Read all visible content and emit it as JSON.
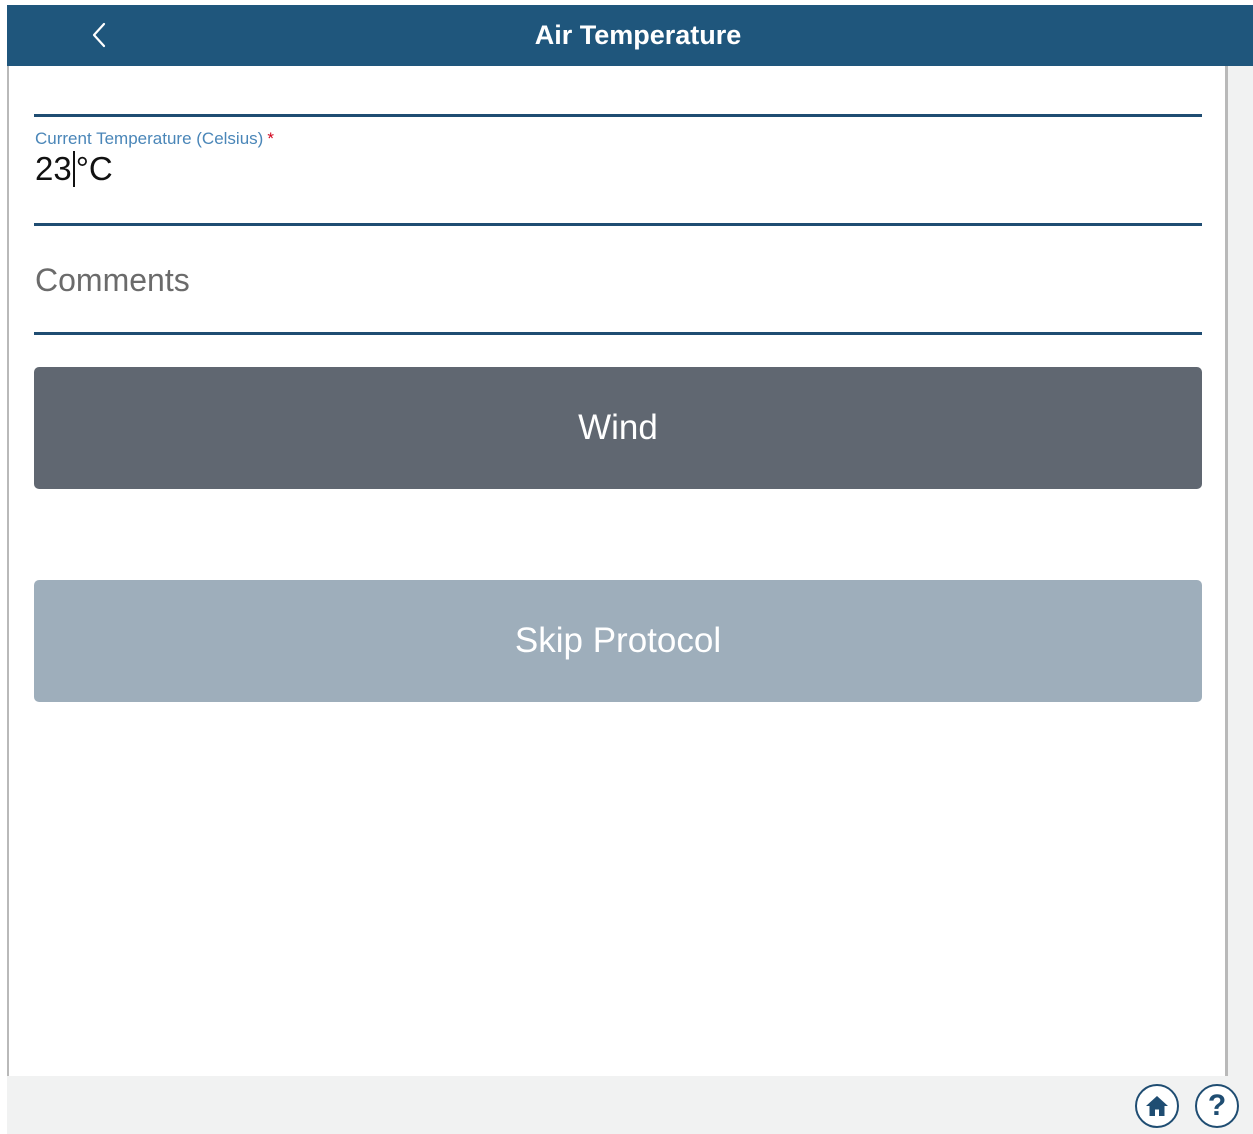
{
  "header": {
    "title": "Air Temperature",
    "back_icon": "chevron-left-icon"
  },
  "temperature_field": {
    "label": "Current Temperature (Celsius)",
    "required_marker": "*",
    "value": "23",
    "unit": "°C"
  },
  "comments_field": {
    "placeholder": "Comments"
  },
  "buttons": {
    "wind_label": "Wind",
    "skip_label": "Skip Protocol"
  },
  "footer": {
    "home_icon": "home-icon",
    "help_glyph": "?"
  },
  "colors": {
    "header_bg": "#1f567c",
    "wind_button": "#606771",
    "skip_button": "#9eaebb",
    "label_blue": "#4a86b8",
    "required_red": "#d0021b"
  }
}
